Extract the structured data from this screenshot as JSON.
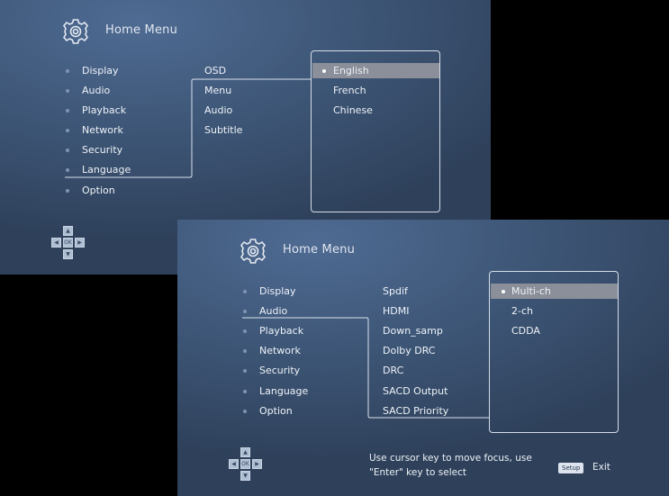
{
  "screen_top": {
    "header": {
      "title": "Home Menu",
      "icon": "gear-icon"
    },
    "main_menu": [
      "Display",
      "Audio",
      "Playback",
      "Network",
      "Security",
      "Language",
      "Option"
    ],
    "active_main": "Language",
    "submenu": [
      "OSD",
      "Menu",
      "Audio",
      "Subtitle"
    ],
    "active_sub": "OSD",
    "options": [
      "English",
      "French",
      "Chinese"
    ],
    "selected_option": "English",
    "dpad": {
      "center_label": "OK"
    }
  },
  "screen_bottom": {
    "header": {
      "title": "Home Menu",
      "icon": "gear-icon"
    },
    "main_menu": [
      "Display",
      "Audio",
      "Playback",
      "Network",
      "Security",
      "Language",
      "Option"
    ],
    "active_main": "Audio",
    "submenu": [
      "Spdif",
      "HDMI",
      "Down_samp",
      "Dolby DRC",
      "DRC",
      "SACD Output",
      "SACD Priority"
    ],
    "active_sub": "Spdif",
    "options": [
      "Multi-ch",
      "2-ch",
      "CDDA"
    ],
    "selected_option": "Multi-ch",
    "dpad": {
      "center_label": "OK"
    },
    "help": {
      "line1": "Use cursor key to move focus, use",
      "line2": "\"Enter\" key to select"
    },
    "setup_key_label": "Setup",
    "exit_label": "Exit"
  },
  "colors": {
    "panel_bg": "#3f5879",
    "highlight": "#8a8f99",
    "text": "#eef2f7",
    "box_border": "#d5dde8"
  }
}
